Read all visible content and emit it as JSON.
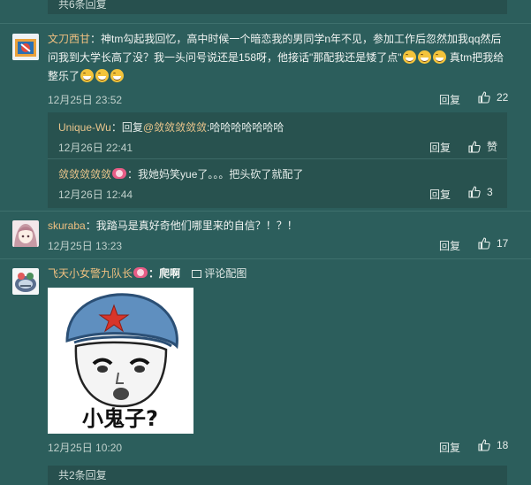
{
  "top_more": {
    "label": "共6条回复"
  },
  "comments": [
    {
      "user": "文刀西甘",
      "text_a": "：神tm勾起我回忆，高中时候一个暗恋我的男同学n年不见，参加工作后忽然加我qq然后问我到大学长高了没？我一头问号说还是158呀，他接话\"那配我还是矮了点\"",
      "text_b": " 真tm把我给整乐了",
      "time": "12月25日 23:52",
      "reply_label": "回复",
      "likes": "22",
      "replies": [
        {
          "user": "Unique-Wu",
          "prefix": "：回复",
          "mention": "@敛敛敛敛敛",
          "text": ":哈哈哈哈哈哈哈",
          "time": "12月26日 22:41",
          "reply_label": "回复",
          "likes": "赞"
        },
        {
          "user": "敛敛敛敛敛",
          "text": "：我她妈笑yue了。。。把头砍了就配了",
          "time": "12月26日 12:44",
          "reply_label": "回复",
          "likes": "3"
        }
      ]
    },
    {
      "user": "skuraba",
      "text": "：我踏马是真好奇他们哪里来的自信？！？！",
      "time": "12月25日 13:23",
      "reply_label": "回复",
      "likes": "17"
    },
    {
      "user": "飞天小女警九队长",
      "text": "：爬啊",
      "image_link": "评论配图",
      "meme_caption": "小鬼子?",
      "time": "12月25日 10:20",
      "reply_label": "回复",
      "likes": "18"
    }
  ],
  "bottom_more": {
    "label": "共2条回复"
  },
  "icons": {
    "like": "thumbs-up-icon",
    "emoji": "laughing-emoji-icon",
    "vip": "vip-badge-icon",
    "image": "image-icon"
  },
  "colors": {
    "background": "#2c5e5c",
    "reply_box": "#28524f",
    "username": "#f0c080"
  }
}
